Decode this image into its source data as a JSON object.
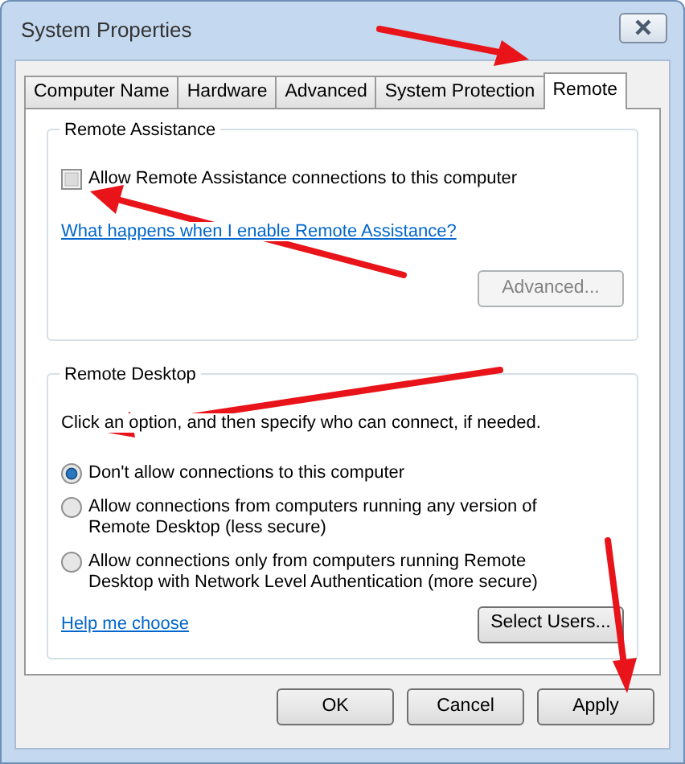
{
  "window": {
    "title": "System Properties"
  },
  "tabs": [
    {
      "label": "Computer Name",
      "selected": false
    },
    {
      "label": "Hardware",
      "selected": false
    },
    {
      "label": "Advanced",
      "selected": false
    },
    {
      "label": "System Protection",
      "selected": false
    },
    {
      "label": "Remote",
      "selected": true
    }
  ],
  "remote_assistance": {
    "title": "Remote Assistance",
    "checkbox": {
      "label": "Allow Remote Assistance connections to this computer",
      "checked": false
    },
    "link": "What happens when I enable Remote Assistance?",
    "button": {
      "label": "Advanced...",
      "disabled": true
    }
  },
  "remote_desktop": {
    "title": "Remote Desktop",
    "instruction": "Click an option, and then specify who can connect, if needed.",
    "options": [
      {
        "label": "Don't allow connections to this computer",
        "selected": true
      },
      {
        "label": "Allow connections from computers running any version of Remote Desktop (less secure)",
        "selected": false
      },
      {
        "label": "Allow connections only from computers running Remote Desktop with Network Level Authentication (more secure)",
        "selected": false
      }
    ],
    "link": "Help me choose",
    "button": {
      "label": "Select Users...",
      "disabled": false
    }
  },
  "buttons": [
    {
      "label": "OK"
    },
    {
      "label": "Cancel"
    },
    {
      "label": "Apply"
    }
  ]
}
